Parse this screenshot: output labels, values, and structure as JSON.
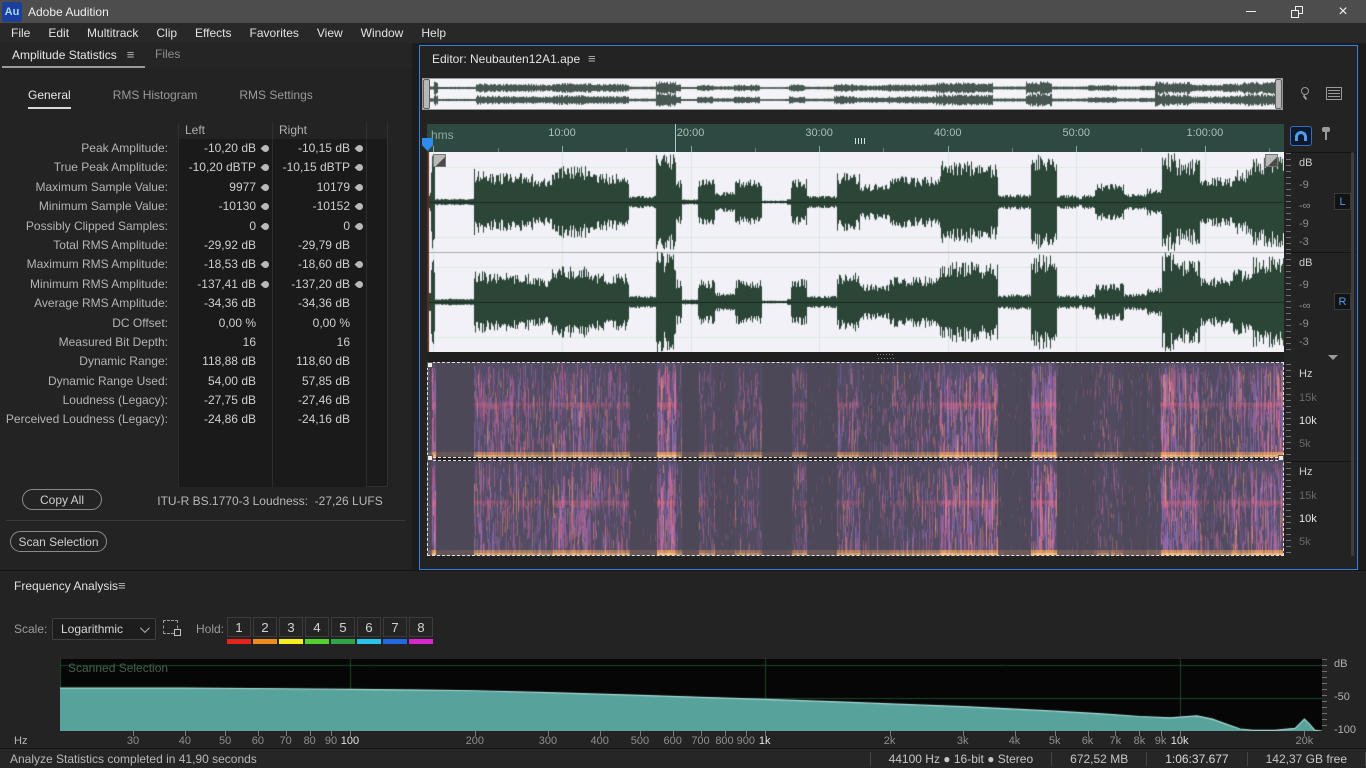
{
  "app": {
    "title": "Adobe Audition",
    "logo": "Au"
  },
  "menu": {
    "items": [
      "File",
      "Edit",
      "Multitrack",
      "Clip",
      "Effects",
      "Favorites",
      "View",
      "Window",
      "Help"
    ]
  },
  "left_panel": {
    "tabs": [
      {
        "label": "Amplitude Statistics",
        "active": true
      },
      {
        "label": "Files",
        "active": false
      }
    ],
    "stat_tabs": [
      "General",
      "RMS Histogram",
      "RMS Settings"
    ],
    "columns": {
      "left": "Left",
      "right": "Right"
    },
    "rows": [
      {
        "label": "Peak Amplitude:",
        "left": "-10,20 dB",
        "right": "-10,15 dB",
        "marker": true
      },
      {
        "label": "True Peak Amplitude:",
        "left": "-10,20 dBTP",
        "right": "-10,15 dBTP",
        "marker": true
      },
      {
        "label": "Maximum Sample Value:",
        "left": "9977",
        "right": "10179",
        "marker": true
      },
      {
        "label": "Minimum Sample Value:",
        "left": "-10130",
        "right": "-10152",
        "marker": true
      },
      {
        "label": "Possibly Clipped Samples:",
        "left": "0",
        "right": "0",
        "marker": true
      },
      {
        "label": "Total RMS Amplitude:",
        "left": "-29,92 dB",
        "right": "-29,79 dB",
        "marker": false
      },
      {
        "label": "Maximum RMS Amplitude:",
        "left": "-18,53 dB",
        "right": "-18,60 dB",
        "marker": true
      },
      {
        "label": "Minimum RMS Amplitude:",
        "left": "-137,41 dB",
        "right": "-137,20 dB",
        "marker": true
      },
      {
        "label": "Average RMS Amplitude:",
        "left": "-34,36 dB",
        "right": "-34,36 dB",
        "marker": false
      },
      {
        "label": "DC Offset:",
        "left": "0,00 %",
        "right": "0,00 %",
        "marker": false
      },
      {
        "label": "Measured Bit Depth:",
        "left": "16",
        "right": "16",
        "marker": false
      },
      {
        "label": "Dynamic Range:",
        "left": "118,88 dB",
        "right": "118,60 dB",
        "marker": false
      },
      {
        "label": "Dynamic Range Used:",
        "left": "54,00 dB",
        "right": "57,85 dB",
        "marker": false
      },
      {
        "label": "Loudness (Legacy):",
        "left": "-27,75 dB",
        "right": "-27,46 dB",
        "marker": false
      },
      {
        "label": "Perceived Loudness (Legacy):",
        "left": "-24,86 dB",
        "right": "-24,16 dB",
        "marker": false
      }
    ],
    "copy_all": "Copy All",
    "loudness_info": "ITU-R BS.1770-3 Loudness:  -27,26 LUFS",
    "scan_selection": "Scan Selection"
  },
  "editor": {
    "title": "Editor: Neubauten12A1.ape",
    "timeline": {
      "unit": "hms",
      "ticks": [
        "10:00",
        "20:00",
        "30:00",
        "40:00",
        "50:00",
        "1:00:00"
      ]
    },
    "db_scale": [
      "dB",
      "-9",
      "-∞",
      "-9",
      "-3"
    ],
    "channels": {
      "left": "L",
      "right": "R"
    },
    "hz_scale": [
      "Hz",
      "15k",
      "10k",
      "5k"
    ]
  },
  "frequency_panel": {
    "title": "Frequency Analysis",
    "scale_label": "Scale:",
    "scale_value": "Logarithmic",
    "hold_label": "Hold:",
    "hold_buttons": [
      {
        "label": "1",
        "color": "#e3241f"
      },
      {
        "label": "2",
        "color": "#ef8d1f"
      },
      {
        "label": "3",
        "color": "#f4ef1d"
      },
      {
        "label": "4",
        "color": "#54d130"
      },
      {
        "label": "5",
        "color": "#2fa646"
      },
      {
        "label": "6",
        "color": "#27c5e8"
      },
      {
        "label": "7",
        "color": "#2368e0"
      },
      {
        "label": "8",
        "color": "#d828cc"
      }
    ],
    "overlay_label": "Scanned Selection"
  },
  "chart_data": {
    "type": "area",
    "title": "Frequency Analysis",
    "xlabel": "Hz",
    "ylabel": "dB",
    "x_scale": "logarithmic",
    "xlim": [
      20,
      22050
    ],
    "ylim": [
      -100,
      0
    ],
    "grid_freqs": [
      100,
      1000,
      10000
    ],
    "grid_dbs": [
      0,
      -50
    ],
    "x_ticks": [
      {
        "label": "30",
        "f": 30
      },
      {
        "label": "40",
        "f": 40
      },
      {
        "label": "50",
        "f": 50
      },
      {
        "label": "60",
        "f": 60
      },
      {
        "label": "70",
        "f": 70
      },
      {
        "label": "80",
        "f": 80
      },
      {
        "label": "90",
        "f": 90
      },
      {
        "label": "100",
        "f": 100,
        "strong": true
      },
      {
        "label": "200",
        "f": 200
      },
      {
        "label": "300",
        "f": 300
      },
      {
        "label": "400",
        "f": 400
      },
      {
        "label": "500",
        "f": 500
      },
      {
        "label": "600",
        "f": 600
      },
      {
        "label": "700",
        "f": 700
      },
      {
        "label": "800",
        "f": 800
      },
      {
        "label": "900",
        "f": 900
      },
      {
        "label": "1k",
        "f": 1000,
        "strong": true
      },
      {
        "label": "2k",
        "f": 2000
      },
      {
        "label": "3k",
        "f": 3000
      },
      {
        "label": "4k",
        "f": 4000
      },
      {
        "label": "5k",
        "f": 5000
      },
      {
        "label": "6k",
        "f": 6000
      },
      {
        "label": "7k",
        "f": 7000
      },
      {
        "label": "8k",
        "f": 8000
      },
      {
        "label": "9k",
        "f": 9000
      },
      {
        "label": "10k",
        "f": 10000,
        "strong": true
      },
      {
        "label": "20k",
        "f": 20000
      }
    ],
    "y_ticks": [
      {
        "label": "dB",
        "db": 0
      },
      {
        "label": "-50",
        "db": -50
      },
      {
        "label": "-100",
        "db": -100
      }
    ],
    "series": [
      {
        "name": "Scanned Selection",
        "color": "#57a29b",
        "points": [
          [
            20,
            -35
          ],
          [
            40,
            -35
          ],
          [
            70,
            -36
          ],
          [
            100,
            -37
          ],
          [
            150,
            -38
          ],
          [
            200,
            -39
          ],
          [
            300,
            -42
          ],
          [
            500,
            -46
          ],
          [
            700,
            -49
          ],
          [
            1000,
            -52
          ],
          [
            1500,
            -56
          ],
          [
            2000,
            -59
          ],
          [
            3000,
            -63
          ],
          [
            4000,
            -67
          ],
          [
            5000,
            -70
          ],
          [
            6500,
            -74
          ],
          [
            8000,
            -78
          ],
          [
            9500,
            -80
          ],
          [
            11000,
            -77
          ],
          [
            12000,
            -82
          ],
          [
            13000,
            -90
          ],
          [
            14000,
            -97
          ],
          [
            15000,
            -99
          ],
          [
            17000,
            -99
          ],
          [
            19000,
            -96
          ],
          [
            20000,
            -82
          ],
          [
            20600,
            -90
          ],
          [
            21200,
            -99
          ],
          [
            22050,
            -100
          ]
        ]
      }
    ]
  },
  "status_bar": {
    "message": "Analyze Statistics completed in 41,90 seconds",
    "format": "44100 Hz ● 16-bit ● Stereo",
    "file_size": "672,52 MB",
    "duration": "1:06:37.677",
    "disk_free": "142,37 GB free"
  }
}
